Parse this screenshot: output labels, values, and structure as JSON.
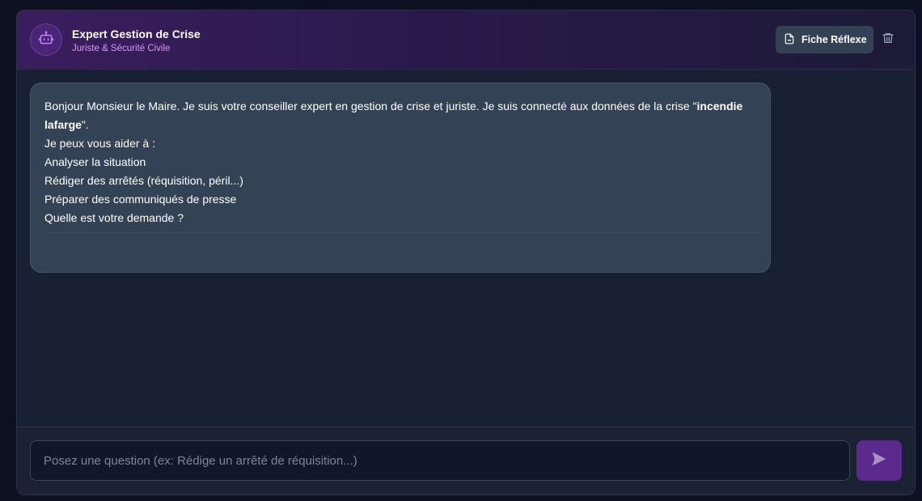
{
  "header": {
    "title": "Expert Gestion de Crise",
    "subtitle": "Juriste & Sécurité Civile",
    "avatar_icon": "robot-icon",
    "fiche_button_label": "Fiche Réflexe",
    "fiche_button_icon": "document-icon",
    "delete_icon": "trash-icon"
  },
  "message": {
    "intro_before": "Bonjour Monsieur le Maire. Je suis votre conseiller expert en gestion de crise et juriste. Je suis connecté aux données de la crise \"",
    "crisis_name": "incendie lafarge",
    "intro_after": "\".",
    "lines": [
      "Je peux vous aider à :",
      "Analyser la situation",
      "Rédiger des arrêtés (réquisition, péril...)",
      "Préparer des communiqués de presse",
      "Quelle est votre demande ?"
    ]
  },
  "composer": {
    "placeholder": "Posez une question (ex: Rédige un arrêté de réquisition...)",
    "value": "",
    "send_icon": "send-icon"
  },
  "colors": {
    "accent": "#5b2a8c",
    "subtitle": "#d49af5",
    "bubble": "#334255",
    "panel": "#182133"
  }
}
